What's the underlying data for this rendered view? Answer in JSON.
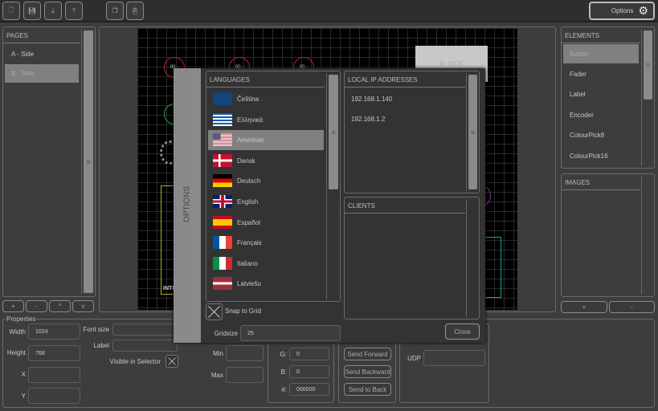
{
  "toolbar": {
    "buttons": [
      {
        "icon": "new-file-icon"
      },
      {
        "icon": "save-icon"
      },
      {
        "icon": "import-icon"
      },
      {
        "icon": "export-icon"
      },
      {
        "icon": "copy-icon"
      },
      {
        "icon": "paste-icon"
      }
    ],
    "options_label": "Options"
  },
  "pages": {
    "header": "PAGES",
    "items": [
      "A - Side",
      "B - Side"
    ],
    "selected": 1,
    "buttons": [
      "+",
      "-",
      "^",
      "v"
    ]
  },
  "canvas": {
    "label_bside": "B- SIDE",
    "fader_label": "INTE",
    "knob_labels": [
      "00 -",
      "00 -",
      "00 -"
    ]
  },
  "elements": {
    "header": "ELEMENTS",
    "items": [
      "Button",
      "Fader",
      "Label",
      "Encoder",
      "ColourPick8",
      "ColourPick16"
    ],
    "selected": 0
  },
  "images": {
    "header": "IMAGES",
    "buttons": [
      "+",
      "-"
    ]
  },
  "properties": {
    "title": "Properties",
    "width_label": "Width",
    "width": "1024",
    "height_label": "Height",
    "height": "768",
    "x_label": "X",
    "y_label": "Y",
    "fontsize_label": "Font size",
    "label_label": "Label",
    "visible_label": "Visible in Selector",
    "min_label": "Min",
    "max_label": "Max",
    "g_label": "G:",
    "g": "0",
    "b_label": "B:",
    "b": "0",
    "hex_label": "#:",
    "hex": "000000",
    "send_forward": "Send Forward",
    "send_backward": "Send Backward",
    "send_to_back": "Send to Back",
    "udp_label": "UDP"
  },
  "dialog": {
    "title": "OPTIONS",
    "languages_header": "LANGUAGES",
    "languages": [
      "Čeština",
      "Ελληνικά",
      "American",
      "Dansk",
      "Deutsch",
      "English",
      "Español",
      "Français",
      "Italiano",
      "Latviešu"
    ],
    "selected_language": 2,
    "ip_header": "LOCAL IP ADDRESSES",
    "ips": [
      "192.168.1.140",
      "192.168.1.2"
    ],
    "clients_header": "CLIENTS",
    "snap_label": "Snap to Grid",
    "gridsize_label": "Gridsize",
    "gridsize": "25",
    "close_label": "Close"
  }
}
